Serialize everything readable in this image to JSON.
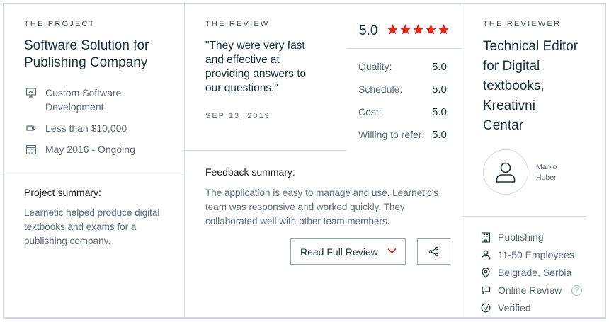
{
  "project": {
    "kicker": "THE PROJECT",
    "title_line1": "Software Solution for",
    "title_line2": "Publishing Company",
    "service_line1": "Custom Software",
    "service_line2": "Development",
    "budget": "Less than $10,000",
    "timeline": "May 2016 - Ongoing",
    "summary_label": "Project summary:",
    "summary_line1": "Learnetic helped produce digital",
    "summary_line2": "textbooks and exams for a",
    "summary_line3": "publishing company."
  },
  "review": {
    "kicker": "THE REVIEW",
    "quote_line1": "\"They were very fast",
    "quote_line2": "and effective at",
    "quote_line3": "providing answers to",
    "quote_line4": "our questions.\"",
    "date": "SEP 13, 2019",
    "feedback_label": "Feedback summary:",
    "feedback_line1": "The application is easy to manage and use. Learnetic's",
    "feedback_line2": "team was responsive and worked quickly. They",
    "feedback_line3": "collaborated well with other team members.",
    "read_button": "Read Full Review"
  },
  "rating": {
    "overall": "5.0",
    "star_count": 5,
    "star_color": "#e62415",
    "rows": [
      {
        "label": "Quality:",
        "value": "5.0"
      },
      {
        "label": "Schedule:",
        "value": "5.0"
      },
      {
        "label": "Cost:",
        "value": "5.0"
      },
      {
        "label": "Willing to refer:",
        "value": "5.0"
      }
    ]
  },
  "reviewer": {
    "kicker": "THE REVIEWER",
    "title_lines": [
      "Technical Editor",
      "for Digital",
      "textbooks,",
      "Kreativni",
      "Centar"
    ],
    "first_name": "Marko",
    "last_name": "Huber",
    "industry": "Publishing",
    "size": "11-50 Employees",
    "location": "Belgrade, Serbia",
    "review_type": "Online Review",
    "help_glyph": "?",
    "verification": "Verified"
  },
  "colors": {
    "accent_red": "#e62415",
    "border": "#d3dde3",
    "heading": "#17313b",
    "muted": "#5c6b73"
  }
}
